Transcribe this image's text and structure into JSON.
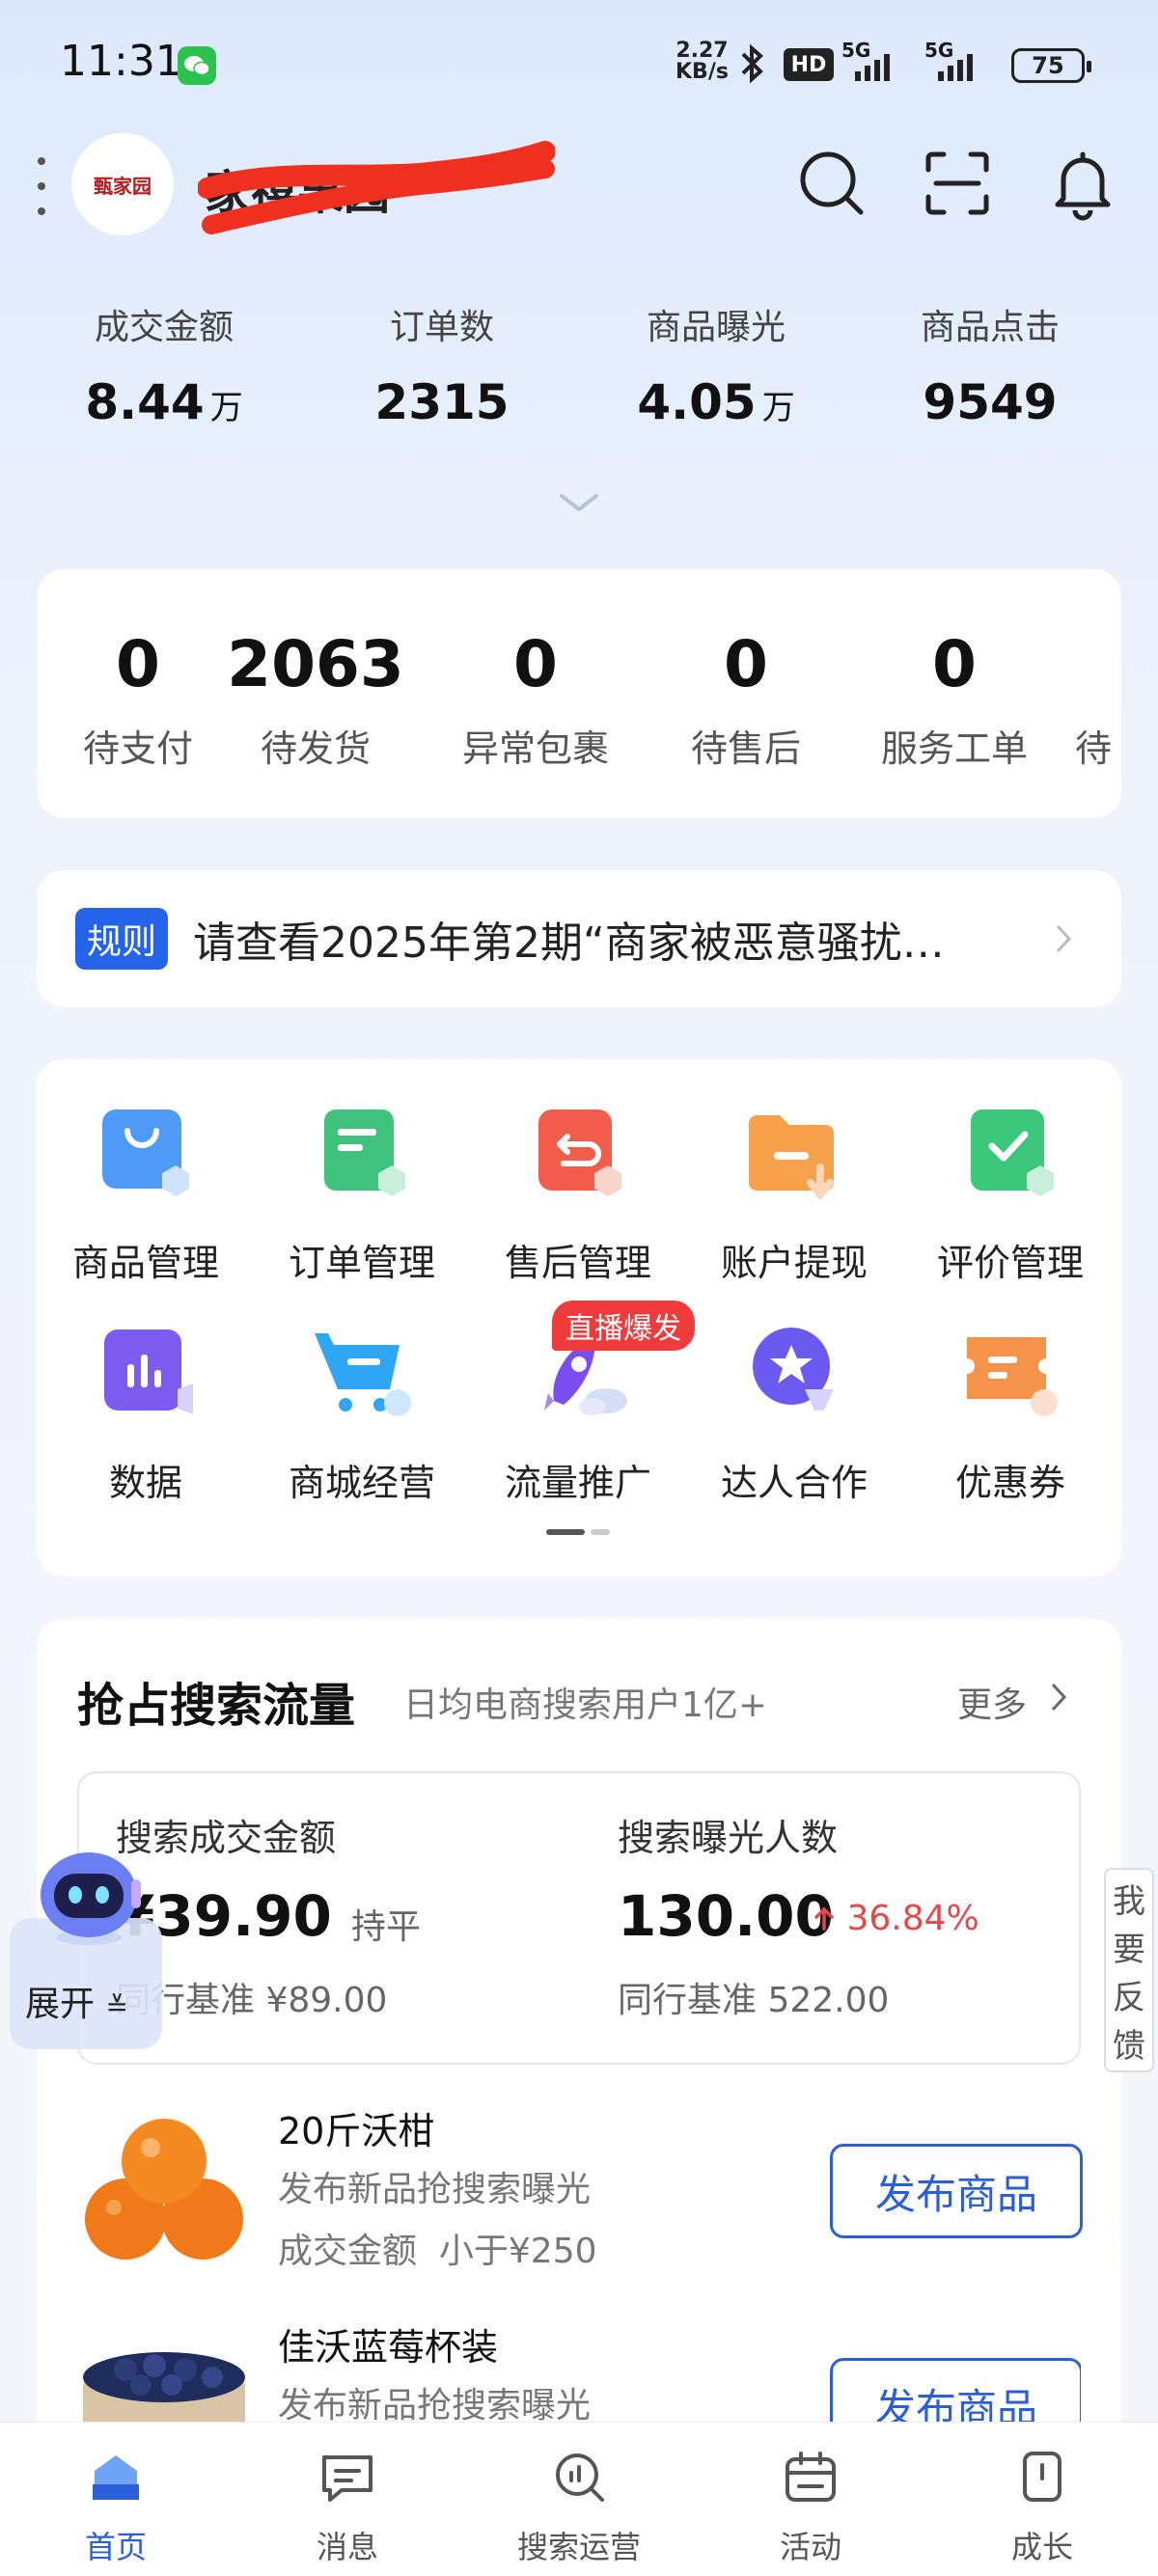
{
  "status_bar": {
    "time": "11:31",
    "net_speed_value": "2.27",
    "net_speed_unit": "KB/s",
    "hd_label": "HD",
    "sig1": "5G",
    "sig2": "5G",
    "battery": "75"
  },
  "header": {
    "shop_name": "家禧果园",
    "avatar_text": "甄家园"
  },
  "stats": [
    {
      "label": "成交金额",
      "value": "8.44",
      "unit": "万"
    },
    {
      "label": "订单数",
      "value": "2315",
      "unit": ""
    },
    {
      "label": "商品曝光",
      "value": "4.05",
      "unit": "万"
    },
    {
      "label": "商品点击",
      "value": "9549",
      "unit": ""
    }
  ],
  "order_status": [
    {
      "value": "0",
      "label": "待支付"
    },
    {
      "value": "2063",
      "label": "待发货"
    },
    {
      "value": "0",
      "label": "异常包裹"
    },
    {
      "value": "0",
      "label": "待售后"
    },
    {
      "value": "0",
      "label": "服务工单"
    },
    {
      "value": "",
      "label": "待"
    }
  ],
  "notice": {
    "tag": "规则",
    "text": "请查看2025年第2期“商家被恶意骚扰…"
  },
  "tools": [
    {
      "label": "商品管理",
      "icon": "product-management-icon",
      "color": "#4d9bf7"
    },
    {
      "label": "订单管理",
      "icon": "order-management-icon",
      "color": "#3fc27c"
    },
    {
      "label": "售后管理",
      "icon": "after-sales-icon",
      "color": "#f25c4a"
    },
    {
      "label": "账户提现",
      "icon": "withdraw-icon",
      "color": "#f5a04a"
    },
    {
      "label": "评价管理",
      "icon": "review-management-icon",
      "color": "#3cc77a"
    },
    {
      "label": "数据",
      "icon": "data-icon",
      "color": "#7c5cf0"
    },
    {
      "label": "商城经营",
      "icon": "mall-cart-icon",
      "color": "#2ea6f2"
    },
    {
      "label": "流量推广",
      "icon": "rocket-icon",
      "color": "#7a4df0"
    },
    {
      "label": "达人合作",
      "icon": "star-badge-icon",
      "color": "#6a5af0"
    },
    {
      "label": "优惠券",
      "icon": "coupon-icon",
      "color": "#f5934a"
    }
  ],
  "hot_badge": "直播爆发",
  "search_section": {
    "title": "抢占搜索流量",
    "subtitle": "日均电商搜索用户1亿+",
    "more": "更多",
    "metrics": [
      {
        "label": "搜索成交金额",
        "value": "¥39.90",
        "side": "持平",
        "bench_prefix": "同行基准",
        "bench_value": "¥89.00",
        "bench_visible": "行基准 ¥89.00",
        "value_visible": "¥39.90"
      },
      {
        "label": "搜索曝光人数",
        "value": "130.00",
        "change": "36.84%",
        "bench": "同行基准 522.00"
      }
    ]
  },
  "assistant": {
    "expand_label": "展开"
  },
  "feedback": [
    "我",
    "要",
    "反",
    "馈"
  ],
  "products": [
    {
      "name": "20斤沃柑",
      "sub": "发布新品抢搜索曝光",
      "detail_label": "成交金额",
      "detail_value": "小于¥250",
      "button": "发布商品"
    },
    {
      "name": "佳沃蓝莓杯装",
      "sub": "发布新品抢搜索曝光",
      "button": "发布商品"
    }
  ],
  "bottom_nav": [
    {
      "label": "首页",
      "active": true
    },
    {
      "label": "消息"
    },
    {
      "label": "搜索运营"
    },
    {
      "label": "活动"
    },
    {
      "label": "成长"
    }
  ],
  "colors": {
    "accent": "#2b5fd9",
    "up": "#e3484c",
    "redact": "#f0301e"
  }
}
